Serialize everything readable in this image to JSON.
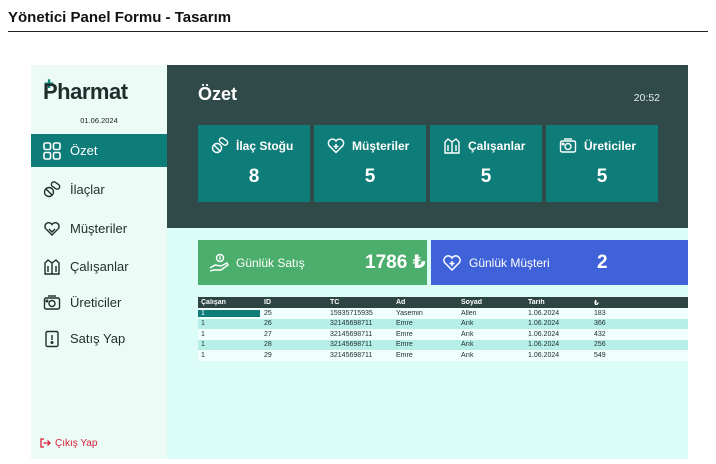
{
  "document": {
    "title": "Yönetici Panel Formu - Tasarım"
  },
  "app": {
    "name": "Pharmat",
    "date": "01.06.2024"
  },
  "sidebar": {
    "items": [
      {
        "label": "Özet",
        "icon": "dashboard-grid-icon",
        "active": true
      },
      {
        "label": "İlaçlar",
        "icon": "pills-icon"
      },
      {
        "label": "Müşteriler",
        "icon": "heart-hands-icon"
      },
      {
        "label": "Çalışanlar",
        "icon": "staff-coat-icon"
      },
      {
        "label": "Üreticiler",
        "icon": "factory-icon"
      },
      {
        "label": "Satış Yap",
        "icon": "receipt-icon"
      }
    ],
    "logout_label": "Çıkış Yap"
  },
  "main": {
    "title": "Özet",
    "clock": "20:52",
    "cards": [
      {
        "label": "İlaç Stoğu",
        "value": "8",
        "icon": "pills-icon"
      },
      {
        "label": "Müşteriler",
        "value": "5",
        "icon": "heart-icon"
      },
      {
        "label": "Çalışanlar",
        "value": "5",
        "icon": "staff-coat-icon"
      },
      {
        "label": "Üreticiler",
        "value": "5",
        "icon": "factory-icon"
      }
    ],
    "daily_sales": {
      "label": "Günlük Satış",
      "value": "1786 ₺",
      "icon": "hand-money-icon"
    },
    "daily_customers": {
      "label": "Günlük Müşteri",
      "value": "2",
      "icon": "heart-icon"
    }
  },
  "table": {
    "headers": [
      "Çalışan",
      "ID",
      "TC",
      "Ad",
      "Soyad",
      "Tarih",
      "₺"
    ],
    "rows": [
      [
        "1",
        "25",
        "15935715935",
        "Yasemin",
        "Allen",
        "1.06.2024",
        "183"
      ],
      [
        "1",
        "26",
        "32145698711",
        "Emre",
        "Arık",
        "1.06.2024",
        "366"
      ],
      [
        "1",
        "27",
        "32145698711",
        "Emre",
        "Arık",
        "1.06.2024",
        "432"
      ],
      [
        "1",
        "28",
        "32145698711",
        "Emre",
        "Arık",
        "1.06.2024",
        "256"
      ],
      [
        "1",
        "29",
        "32145698711",
        "Emre",
        "Arık",
        "1.06.2024",
        "549"
      ]
    ]
  },
  "colors": {
    "accent": "#0e7c78",
    "header_band": "#2f4a49",
    "sales_green": "#4cae6c",
    "customer_blue": "#4062d8",
    "logout_red": "#d9203a"
  }
}
